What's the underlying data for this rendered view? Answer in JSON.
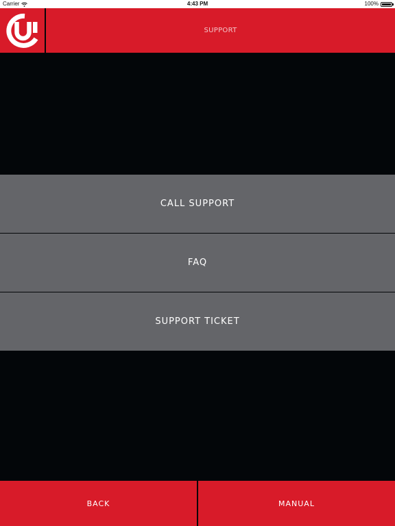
{
  "status_bar": {
    "carrier": "Carrier",
    "time": "4:43 PM",
    "battery": "100%",
    "battery_level": 1.0,
    "wifi_icon": "wifi-icon",
    "battery_icon": "battery-icon"
  },
  "header": {
    "title": "SUPPORT",
    "logo_icon": "brand-logo-icon"
  },
  "menu": {
    "call_support": "CALL SUPPORT",
    "faq": "FAQ",
    "support_ticket": "SUPPORT TICKET"
  },
  "footer": {
    "back": "BACK",
    "manual": "MANUAL"
  },
  "colors": {
    "brand_red": "#d81b29",
    "button_gray": "#646569",
    "background": "#030609",
    "text_white": "#ffffff"
  }
}
